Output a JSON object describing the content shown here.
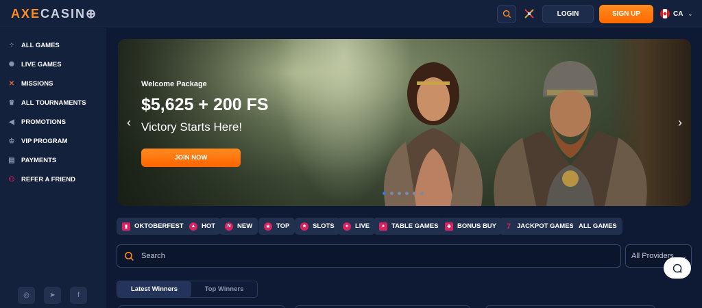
{
  "header": {
    "logo_axe": "AXE",
    "logo_casino": "CASIN",
    "login_label": "LOGIN",
    "signup_label": "SIGN UP",
    "language": "CA"
  },
  "sidebar": {
    "items": [
      {
        "label": "ALL GAMES",
        "icon": "dice-icon"
      },
      {
        "label": "LIVE GAMES",
        "icon": "roulette-icon"
      },
      {
        "label": "MISSIONS",
        "icon": "crossed-swords-icon"
      },
      {
        "label": "ALL TOURNAMENTS",
        "icon": "trophy-icon"
      },
      {
        "label": "PROMOTIONS",
        "icon": "megaphone-icon"
      },
      {
        "label": "VIP PROGRAM",
        "icon": "crown-icon"
      },
      {
        "label": "PAYMENTS",
        "icon": "card-icon"
      },
      {
        "label": "REFER A FRIEND",
        "icon": "friends-icon"
      }
    ],
    "socials": [
      "instagram-icon",
      "telegram-icon",
      "facebook-icon"
    ]
  },
  "banner": {
    "kicker": "Welcome Package",
    "title": "$5,625 + 200 FS",
    "subtitle": "Victory Starts Here!",
    "cta": "JOIN NOW",
    "slides_total": 6,
    "active_slide": 1
  },
  "categories": [
    {
      "label": "OKTOBERFEST",
      "icon": "beer-icon"
    },
    {
      "label": "HOT",
      "icon": "fire-icon"
    },
    {
      "label": "NEW",
      "icon": "new-icon"
    },
    {
      "label": "TOP",
      "icon": "star-icon"
    },
    {
      "label": "SLOTS",
      "icon": "cherries-icon"
    },
    {
      "label": "LIVE",
      "icon": "live-icon"
    },
    {
      "label": "TABLE GAMES",
      "icon": "cards-icon"
    },
    {
      "label": "BONUS BUY",
      "icon": "gift-icon"
    },
    {
      "label": "JACKPOT GAMES",
      "icon": "seven-icon"
    },
    {
      "label": "ALL GAMES",
      "icon": ""
    }
  ],
  "search": {
    "placeholder": "Search"
  },
  "providers": {
    "selected": "All Providers"
  },
  "winners_tabs": [
    "Latest Winners",
    "Top Winners"
  ],
  "colors": {
    "accent": "#ff7a10",
    "background": "#0e1a33",
    "panel": "#14213d",
    "category_icon": "#d9235f"
  }
}
